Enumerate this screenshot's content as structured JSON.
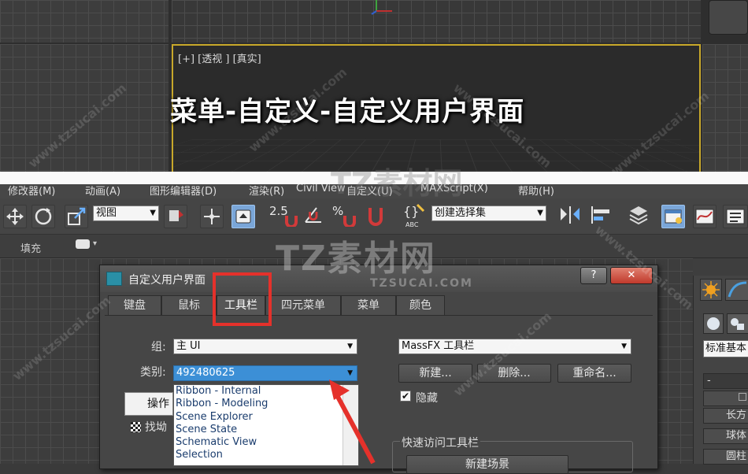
{
  "overlay_title": "菜单-自定义-自定义用户界面",
  "viewport": {
    "label": "[+] [透视 ] [真实]"
  },
  "menubar": {
    "items": [
      "修改器(M)",
      "动画(A)",
      "图形编辑器(D)",
      "渲染(R)",
      "Civil View",
      "自定义(U)",
      "MAXScript(X)",
      "帮助(H)"
    ]
  },
  "toolbar": {
    "view_combo": "视图",
    "snap_value": "2.5",
    "percent_label": "%",
    "named_selection_combo": "创建选择集"
  },
  "row2": {
    "fill_label": "填充"
  },
  "dialog": {
    "title": "自定义用户界面",
    "help_button": "?",
    "close_button": "✕",
    "tabs": [
      {
        "label": "键盘",
        "active": false
      },
      {
        "label": "鼠标",
        "active": false
      },
      {
        "label": "工具栏",
        "active": true
      },
      {
        "label": "四元菜单",
        "active": false
      },
      {
        "label": "菜单",
        "active": false
      },
      {
        "label": "颜色",
        "active": false
      }
    ],
    "group_label": "组:",
    "group_value": "主 UI",
    "category_label": "类别:",
    "category_value": "492480625",
    "category_options": [
      "Ribbon - Internal",
      "Ribbon - Modeling",
      "Scene Explorer",
      "Scene State",
      "Schematic View",
      "Selection"
    ],
    "ops_header": "操作",
    "ops_item": "找坳",
    "toolbar_select": "MassFX 工具栏",
    "new_button": "新建...",
    "delete_button": "删除...",
    "rename_button": "重命名...",
    "hide_label": "隐藏",
    "hide_checked": true,
    "quick_access_label": "快速访问工具栏",
    "quick_access_button": "新建场景"
  },
  "command_panel": {
    "standard_combo": "标准基本",
    "buttons": [
      "长方",
      "球体",
      "圆柱"
    ]
  },
  "watermark": {
    "brand": "TZ素材网",
    "domain": "TZSUCAI.COM",
    "url": "www.tzsucai.com"
  },
  "colors": {
    "accent": "#3c8fd6",
    "highlight": "#e5312b",
    "viewport_border": "#c8a82a"
  }
}
